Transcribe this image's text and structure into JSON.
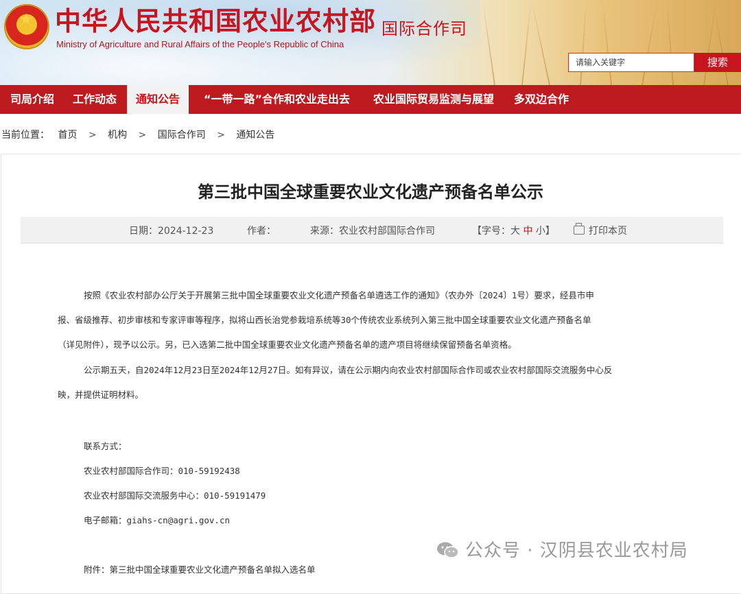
{
  "header": {
    "site_title": "中华人民共和国农业农村部",
    "site_subtitle": "Ministry of Agriculture and Rural Affairs of the People's Republic of China",
    "department": "国际合作司",
    "emblem_icon": "national-emblem-icon",
    "search": {
      "placeholder": "请输入关键字",
      "button_label": "搜索"
    },
    "colors": {
      "brand_red": "#c8141e",
      "nav_red": "#bd1a1f"
    }
  },
  "nav": {
    "items": [
      {
        "label": "司局介绍"
      },
      {
        "label": "工作动态"
      },
      {
        "label": "通知公告"
      },
      {
        "label": "“一带一路”合作和农业走出去"
      },
      {
        "label": "农业国际贸易监测与展望"
      },
      {
        "label": "多双边合作"
      }
    ],
    "active": "通知公告"
  },
  "breadcrumb": {
    "prefix": "当前位置：",
    "items": [
      "首页",
      "机构",
      "国际合作司",
      "通知公告"
    ],
    "separator": ">"
  },
  "article": {
    "title": "第三批中国全球重要农业文化遗产预备名单公示",
    "meta": {
      "date_label": "日期：",
      "date": "2024-12-23",
      "author_label": "作者：",
      "source_label": "来源：",
      "source": "农业农村部国际合作司",
      "fontsize_label": "【字号：",
      "size_large": "大",
      "size_medium": "中",
      "size_small": "小】",
      "print_label": "打印本页"
    },
    "paragraph1": [
      "按照《农业农村部办公厅关于开展第三批中国全球重要农业文化遗产预备名单遴选工作的通知》（农办外〔2024〕1号）要求，经县市申",
      "报、省级推荐、初步审核和专家评审等程序，拟将山西长治党参栽培系统等30个传统农业系统列入第三批中国全球重要农业文化遗产预备名单",
      "（详见附件），现予以公示。另，已入选第二批中国全球重要农业文化遗产预备名单的遗产项目将继续保留预备名单资格。"
    ],
    "paragraph2": [
      "公示期五天，自2024年12月23日至2024年12月27日。如有异议，请在公示期内向农业农村部国际合作司或农业农村部国际交流服务中心反",
      "映，并提供证明材料。"
    ],
    "contact": {
      "heading": "联系方式：",
      "line1": "农业农村部国际合作司：010-59192438",
      "line2": "农业农村部国际交流服务中心：010-59191479",
      "line3": "电子邮箱：giahs-cn@agri.gov.cn"
    },
    "attachment": "附件：第三批中国全球重要农业文化遗产预备名单拟入选名单"
  },
  "watermark": {
    "text": "公众号 · 汉阴县农业农村局",
    "icon": "wechat-icon"
  }
}
